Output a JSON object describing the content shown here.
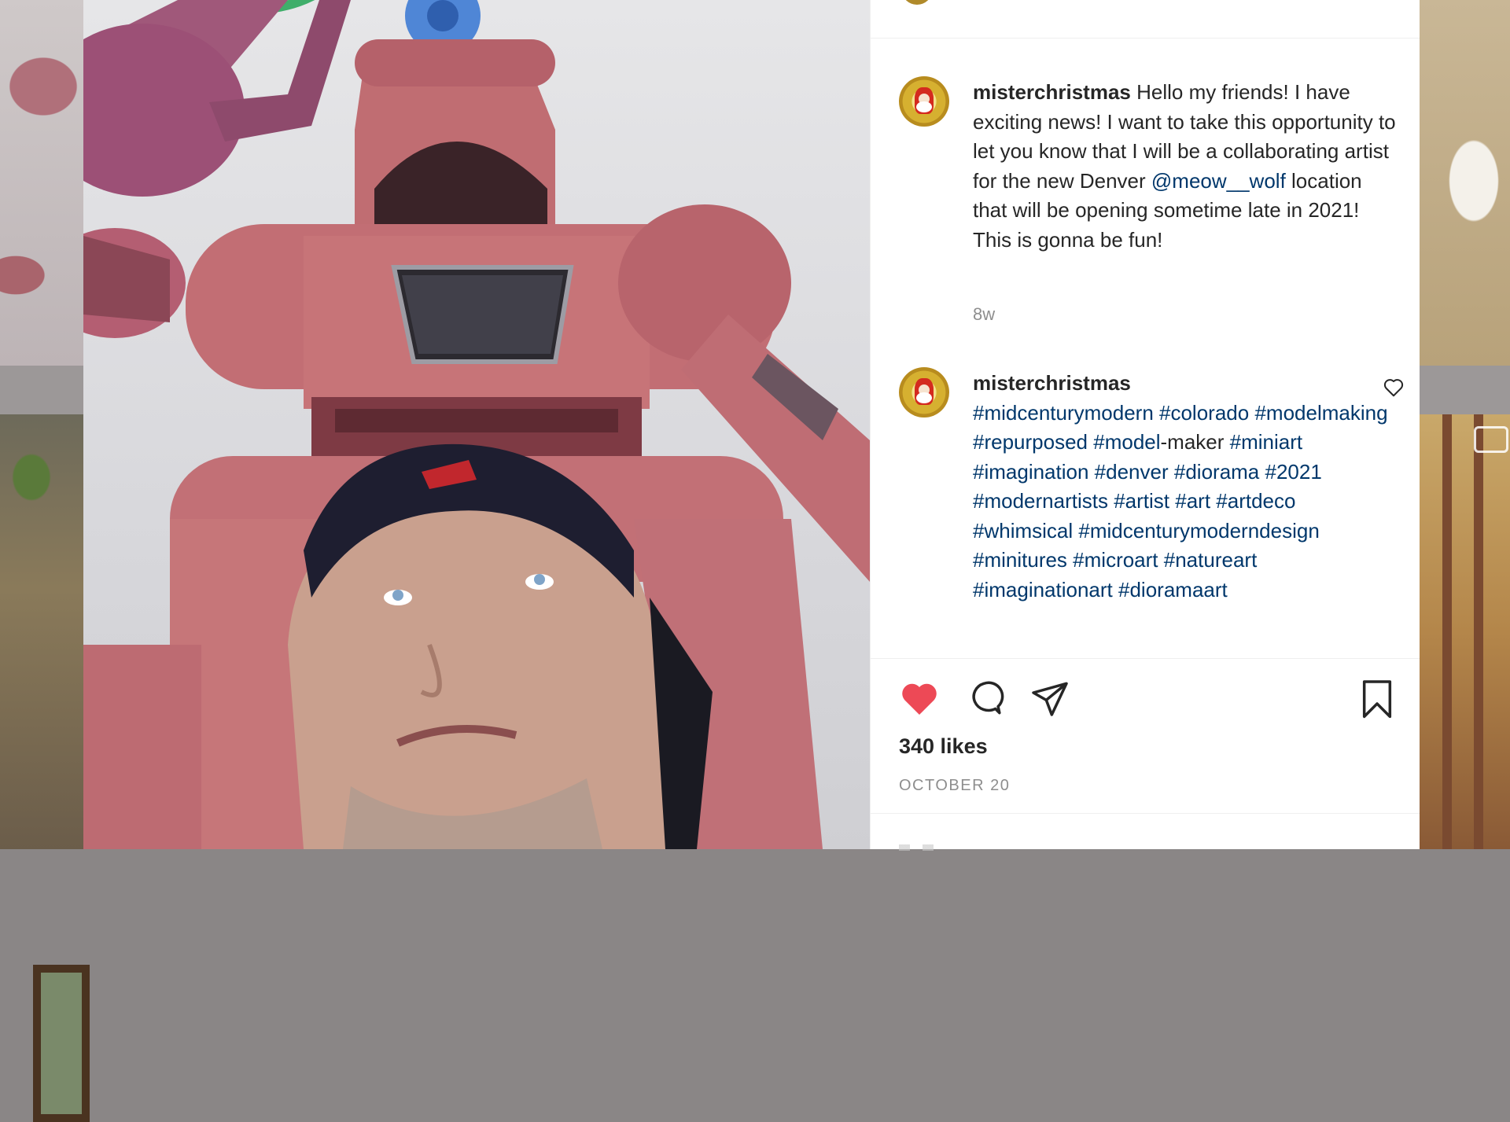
{
  "post": {
    "author": "misterchristmas",
    "caption": {
      "username": "misterchristmas",
      "text_1": " Hello my friends! I have exciting news! I want to take this opportunity to let you know that I will be a collaborating artist for the new Denver ",
      "mention": "@meow__wolf",
      "text_2": " location that will be opening sometime late in 2021! This is gonna be fun!",
      "time_ago": "8w"
    },
    "comment": {
      "username": "misterchristmas",
      "hashtags_1": [
        "#midcenturymodern",
        "#colorado",
        "#modelmaking",
        "#repurposed",
        "#model"
      ],
      "plain": "-maker",
      "hashtags_2": [
        "#miniart",
        "#imagination",
        "#denver",
        "#diorama",
        "#2021",
        "#modernartists",
        "#artist",
        "#art",
        "#artdeco",
        "#whimsical",
        "#midcenturymoderndesign",
        "#minitures",
        "#microart",
        "#natureart",
        "#imaginationart",
        "#dioramaart"
      ]
    },
    "likes": "340 likes",
    "date": "OCTOBER 20"
  },
  "icons": {
    "like": "heart-filled-icon",
    "comment": "comment-bubble-icon",
    "share": "paper-plane-icon",
    "save": "bookmark-icon",
    "comment_like": "heart-outline-icon",
    "carousel": "carousel-icon"
  },
  "colors": {
    "link": "#00376b",
    "like_active": "#ed4956",
    "text": "#262626",
    "muted": "#8e8e8e",
    "divider": "#efefef"
  }
}
